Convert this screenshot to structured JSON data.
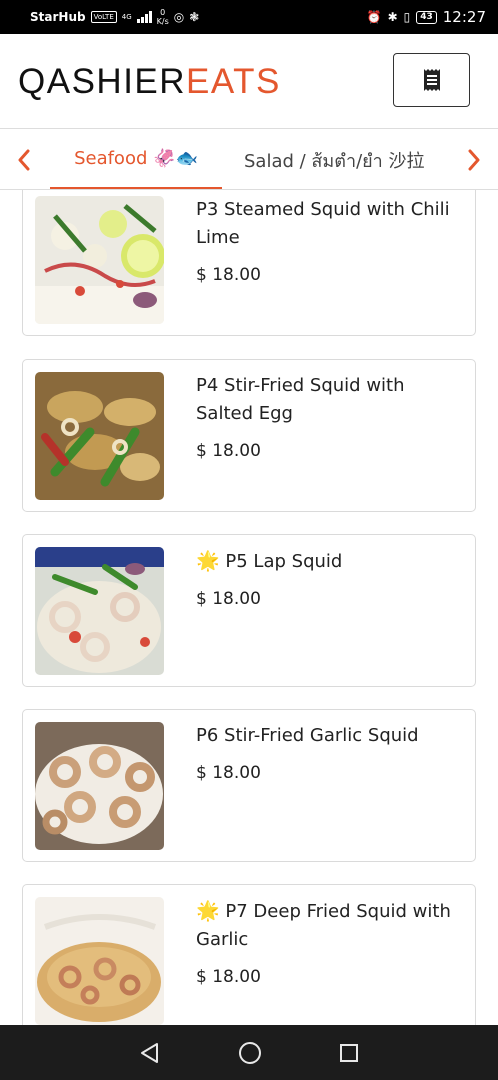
{
  "status_bar": {
    "carrier": "StarHub",
    "volte": "VoLTE",
    "network": "4G",
    "speed_value": "0",
    "speed_unit": "K/s",
    "battery": "43",
    "time": "12:27"
  },
  "header": {
    "logo_part1": "QASHIER",
    "logo_part2": "EATS",
    "brand_color": "#e4572e",
    "cart_icon": "receipt-icon"
  },
  "categories": {
    "active": "Seafood 🦑🐟",
    "next": "Salad / ส้มตำ/ยำ 沙拉"
  },
  "menu_items": [
    {
      "name": "P3 Steamed Squid with Chili Lime",
      "price": "$ 18.00",
      "featured": false
    },
    {
      "name": "P4 Stir-Fried Squid with Salted Egg",
      "price": "$ 18.00",
      "featured": false
    },
    {
      "name": "P5 Lap Squid",
      "price": "$ 18.00",
      "featured": true
    },
    {
      "name": "P6 Stir-Fried Garlic Squid",
      "price": "$ 18.00",
      "featured": false
    },
    {
      "name": "P7 Deep Fried Squid with Garlic",
      "price": "$ 18.00",
      "featured": true
    }
  ],
  "featured_icon": "🌟"
}
